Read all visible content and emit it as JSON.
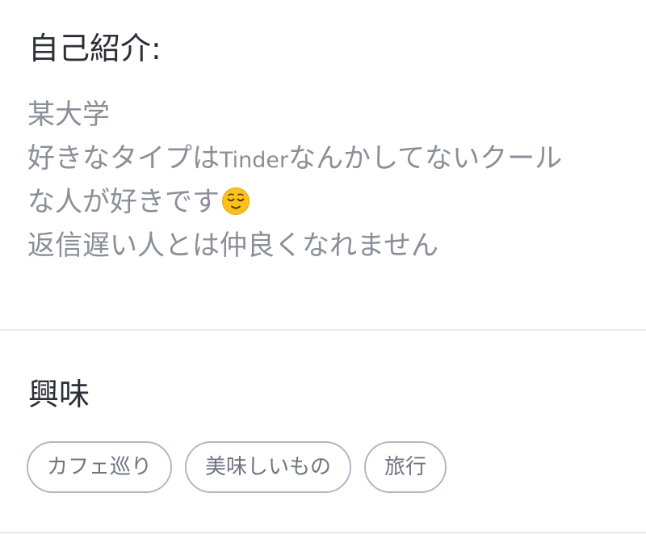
{
  "bio": {
    "title": "自己紹介:",
    "line1": "某大学",
    "line2_part1": "好きなタイプは",
    "line2_latin": "Tinder",
    "line2_part2": "なんかしてないクール",
    "line3": "な人が好きです",
    "line3_emoji": "relieved-face-icon",
    "line4": "返信遅い人とは仲良くなれません"
  },
  "interests": {
    "title": "興味",
    "tags": [
      "カフェ巡り",
      "美味しいもの",
      "旅行"
    ]
  },
  "colors": {
    "title_text": "#2b2f36",
    "body_text": "#8a8f98",
    "chip_border": "#aeb8c5",
    "chip_text": "#6f7680",
    "divider": "#e6e8eb",
    "emoji_face": "#fcc21b"
  }
}
